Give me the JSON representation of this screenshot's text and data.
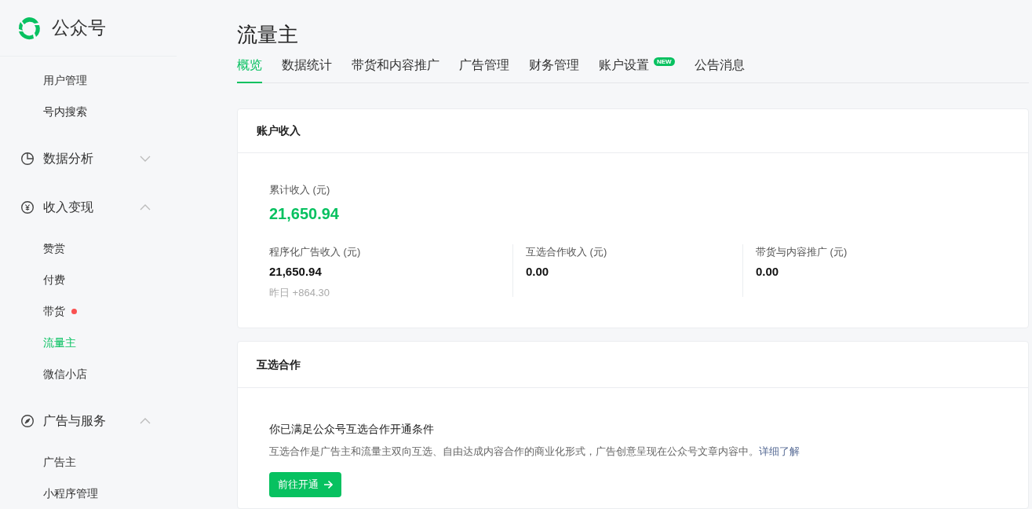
{
  "brand": {
    "name": "公众号"
  },
  "sidebar": {
    "items": [
      {
        "kind": "link",
        "label": "用户管理",
        "selected": false,
        "dot": false
      },
      {
        "kind": "link",
        "label": "号内搜索",
        "selected": false,
        "dot": false
      },
      {
        "kind": "group",
        "label": "数据分析",
        "expanded": false
      },
      {
        "kind": "group",
        "label": "收入变现",
        "expanded": true,
        "children": [
          {
            "kind": "link",
            "label": "赞赏",
            "selected": false,
            "dot": false
          },
          {
            "kind": "link",
            "label": "付费",
            "selected": false,
            "dot": false
          },
          {
            "kind": "link",
            "label": "带货",
            "selected": false,
            "dot": true
          },
          {
            "kind": "link",
            "label": "流量主",
            "selected": true,
            "dot": false
          },
          {
            "kind": "link",
            "label": "微信小店",
            "selected": false,
            "dot": false
          }
        ]
      },
      {
        "kind": "group",
        "label": "广告与服务",
        "expanded": true,
        "children": [
          {
            "kind": "link",
            "label": "广告主",
            "selected": false,
            "dot": false
          },
          {
            "kind": "link",
            "label": "小程序管理",
            "selected": false,
            "dot": false
          }
        ]
      }
    ]
  },
  "page": {
    "title": "流量主"
  },
  "tabs": [
    {
      "label": "概览",
      "selected": true
    },
    {
      "label": "数据统计",
      "selected": false
    },
    {
      "label": "带货和内容推广",
      "selected": false
    },
    {
      "label": "广告管理",
      "selected": false
    },
    {
      "label": "财务管理",
      "selected": false
    },
    {
      "label": "账户设置",
      "selected": false,
      "badge": "NEW"
    },
    {
      "label": "公告消息",
      "selected": false
    }
  ],
  "income_card": {
    "title": "账户收入",
    "total_label": "累计收入 (元)",
    "total_value": "21,650.94",
    "stats": [
      {
        "label": "程序化广告收入 (元)",
        "value": "21,650.94",
        "note": "昨日 +864.30"
      },
      {
        "label": "互选合作收入 (元)",
        "value": "0.00"
      },
      {
        "label": "带货与内容推广 (元)",
        "value": "0.00"
      }
    ]
  },
  "coop_card": {
    "title": "互选合作",
    "heading": "你已满足公众号互选合作开通条件",
    "description": "互选合作是广告主和流量主双向互选、自由达成内容合作的商业化形式，广告创意呈现在公众号文章内容中。",
    "link": "详细了解",
    "button": "前往开通"
  }
}
